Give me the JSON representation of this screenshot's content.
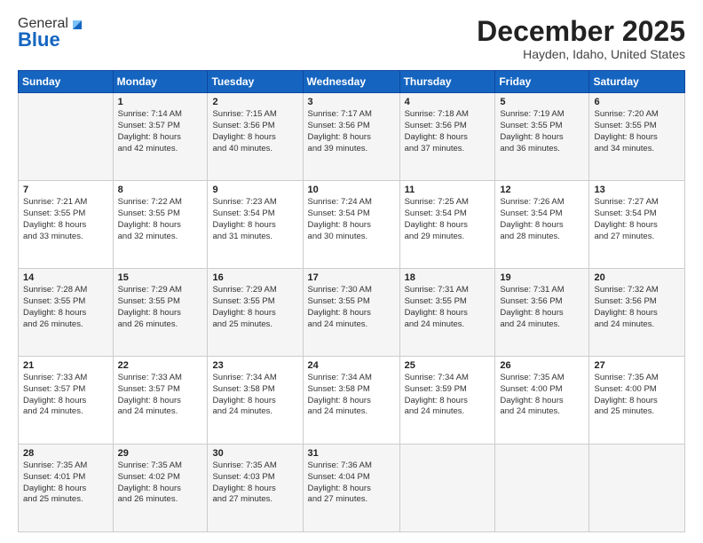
{
  "logo": {
    "general": "General",
    "blue": "Blue"
  },
  "header": {
    "month": "December 2025",
    "location": "Hayden, Idaho, United States"
  },
  "weekdays": [
    "Sunday",
    "Monday",
    "Tuesday",
    "Wednesday",
    "Thursday",
    "Friday",
    "Saturday"
  ],
  "weeks": [
    [
      {
        "day": "",
        "content": ""
      },
      {
        "day": "1",
        "content": "Sunrise: 7:14 AM\nSunset: 3:57 PM\nDaylight: 8 hours\nand 42 minutes."
      },
      {
        "day": "2",
        "content": "Sunrise: 7:15 AM\nSunset: 3:56 PM\nDaylight: 8 hours\nand 40 minutes."
      },
      {
        "day": "3",
        "content": "Sunrise: 7:17 AM\nSunset: 3:56 PM\nDaylight: 8 hours\nand 39 minutes."
      },
      {
        "day": "4",
        "content": "Sunrise: 7:18 AM\nSunset: 3:56 PM\nDaylight: 8 hours\nand 37 minutes."
      },
      {
        "day": "5",
        "content": "Sunrise: 7:19 AM\nSunset: 3:55 PM\nDaylight: 8 hours\nand 36 minutes."
      },
      {
        "day": "6",
        "content": "Sunrise: 7:20 AM\nSunset: 3:55 PM\nDaylight: 8 hours\nand 34 minutes."
      }
    ],
    [
      {
        "day": "7",
        "content": "Sunrise: 7:21 AM\nSunset: 3:55 PM\nDaylight: 8 hours\nand 33 minutes."
      },
      {
        "day": "8",
        "content": "Sunrise: 7:22 AM\nSunset: 3:55 PM\nDaylight: 8 hours\nand 32 minutes."
      },
      {
        "day": "9",
        "content": "Sunrise: 7:23 AM\nSunset: 3:54 PM\nDaylight: 8 hours\nand 31 minutes."
      },
      {
        "day": "10",
        "content": "Sunrise: 7:24 AM\nSunset: 3:54 PM\nDaylight: 8 hours\nand 30 minutes."
      },
      {
        "day": "11",
        "content": "Sunrise: 7:25 AM\nSunset: 3:54 PM\nDaylight: 8 hours\nand 29 minutes."
      },
      {
        "day": "12",
        "content": "Sunrise: 7:26 AM\nSunset: 3:54 PM\nDaylight: 8 hours\nand 28 minutes."
      },
      {
        "day": "13",
        "content": "Sunrise: 7:27 AM\nSunset: 3:54 PM\nDaylight: 8 hours\nand 27 minutes."
      }
    ],
    [
      {
        "day": "14",
        "content": "Sunrise: 7:28 AM\nSunset: 3:55 PM\nDaylight: 8 hours\nand 26 minutes."
      },
      {
        "day": "15",
        "content": "Sunrise: 7:29 AM\nSunset: 3:55 PM\nDaylight: 8 hours\nand 26 minutes."
      },
      {
        "day": "16",
        "content": "Sunrise: 7:29 AM\nSunset: 3:55 PM\nDaylight: 8 hours\nand 25 minutes."
      },
      {
        "day": "17",
        "content": "Sunrise: 7:30 AM\nSunset: 3:55 PM\nDaylight: 8 hours\nand 24 minutes."
      },
      {
        "day": "18",
        "content": "Sunrise: 7:31 AM\nSunset: 3:55 PM\nDaylight: 8 hours\nand 24 minutes."
      },
      {
        "day": "19",
        "content": "Sunrise: 7:31 AM\nSunset: 3:56 PM\nDaylight: 8 hours\nand 24 minutes."
      },
      {
        "day": "20",
        "content": "Sunrise: 7:32 AM\nSunset: 3:56 PM\nDaylight: 8 hours\nand 24 minutes."
      }
    ],
    [
      {
        "day": "21",
        "content": "Sunrise: 7:33 AM\nSunset: 3:57 PM\nDaylight: 8 hours\nand 24 minutes."
      },
      {
        "day": "22",
        "content": "Sunrise: 7:33 AM\nSunset: 3:57 PM\nDaylight: 8 hours\nand 24 minutes."
      },
      {
        "day": "23",
        "content": "Sunrise: 7:34 AM\nSunset: 3:58 PM\nDaylight: 8 hours\nand 24 minutes."
      },
      {
        "day": "24",
        "content": "Sunrise: 7:34 AM\nSunset: 3:58 PM\nDaylight: 8 hours\nand 24 minutes."
      },
      {
        "day": "25",
        "content": "Sunrise: 7:34 AM\nSunset: 3:59 PM\nDaylight: 8 hours\nand 24 minutes."
      },
      {
        "day": "26",
        "content": "Sunrise: 7:35 AM\nSunset: 4:00 PM\nDaylight: 8 hours\nand 24 minutes."
      },
      {
        "day": "27",
        "content": "Sunrise: 7:35 AM\nSunset: 4:00 PM\nDaylight: 8 hours\nand 25 minutes."
      }
    ],
    [
      {
        "day": "28",
        "content": "Sunrise: 7:35 AM\nSunset: 4:01 PM\nDaylight: 8 hours\nand 25 minutes."
      },
      {
        "day": "29",
        "content": "Sunrise: 7:35 AM\nSunset: 4:02 PM\nDaylight: 8 hours\nand 26 minutes."
      },
      {
        "day": "30",
        "content": "Sunrise: 7:35 AM\nSunset: 4:03 PM\nDaylight: 8 hours\nand 27 minutes."
      },
      {
        "day": "31",
        "content": "Sunrise: 7:36 AM\nSunset: 4:04 PM\nDaylight: 8 hours\nand 27 minutes."
      },
      {
        "day": "",
        "content": ""
      },
      {
        "day": "",
        "content": ""
      },
      {
        "day": "",
        "content": ""
      }
    ]
  ]
}
